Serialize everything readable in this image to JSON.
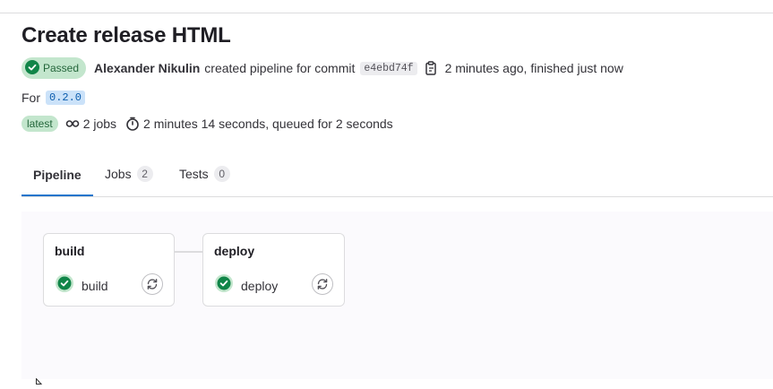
{
  "pipeline": {
    "title": "Create release HTML",
    "status_label": "Passed",
    "author": "Alexander Nikulin",
    "action_text": "created pipeline for commit",
    "commit_sha": "e4ebd74f",
    "time_text": "2 minutes ago, finished just now",
    "for_label": "For",
    "ref": "0.2.0",
    "latest_label": "latest",
    "jobs_text": "2 jobs",
    "duration_text": "2 minutes 14 seconds, queued for 2 seconds"
  },
  "tabs": [
    {
      "label": "Pipeline",
      "count": null,
      "active": true
    },
    {
      "label": "Jobs",
      "count": "2"
    },
    {
      "label": "Tests",
      "count": "0"
    }
  ],
  "stages": [
    {
      "name": "build",
      "jobs": [
        {
          "name": "build",
          "status": "success"
        }
      ]
    },
    {
      "name": "deploy",
      "jobs": [
        {
          "name": "deploy",
          "status": "success"
        }
      ]
    }
  ],
  "colors": {
    "success": "#108548",
    "active_tab": "#1f75cb",
    "passed_badge_bg": "#c3e6cd"
  },
  "icons": [
    "status-success-icon",
    "copy-icon",
    "pipeline-jobs-icon",
    "timer-icon",
    "retry-icon",
    "mouse-cursor-icon"
  ]
}
